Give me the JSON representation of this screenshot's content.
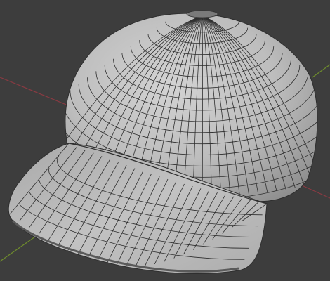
{
  "viewport": {
    "background": "#3d3d3d",
    "axes": {
      "x_axis_color": "#8a3a42",
      "y_axis_color": "#6e8c2c"
    },
    "mesh": {
      "object": "cap",
      "shading": "solid",
      "overlay": "wireframe",
      "surface_color": "#b9b9b9",
      "wire_color": "#2e2e2e"
    }
  }
}
